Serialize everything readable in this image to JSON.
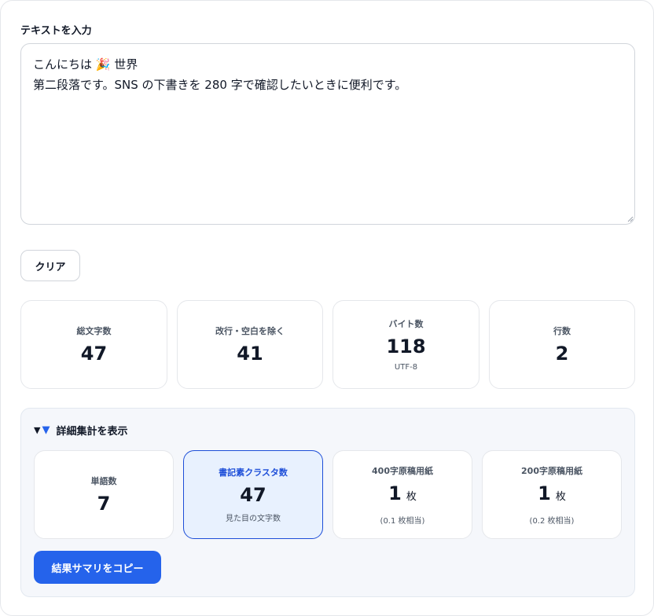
{
  "input": {
    "label": "テキストを入力",
    "text": "こんにちは 🎉 世界\n第二段落です。SNS の下書きを 280 字で確認したいときに便利です。"
  },
  "clear_label": "クリア",
  "stats": [
    {
      "label": "総文字数",
      "value": "47"
    },
    {
      "label": "改行・空白を除く",
      "value": "41"
    },
    {
      "label": "バイト数",
      "value": "118",
      "sub": "UTF-8"
    },
    {
      "label": "行数",
      "value": "2"
    }
  ],
  "details": {
    "summary_label": "詳細集計を表示",
    "items": [
      {
        "label": "単語数",
        "value": "7"
      },
      {
        "label": "書記素クラスタ数",
        "value": "47",
        "sub": "見た目の文字数"
      },
      {
        "label": "400字原稿用紙",
        "value": "1",
        "unit": "枚",
        "sub": "(0.1 枚相当)"
      },
      {
        "label": "200字原稿用紙",
        "value": "1",
        "unit": "枚",
        "sub": "(0.2 枚相当)"
      }
    ],
    "copy_label": "結果サマリをコピー"
  },
  "colors": {
    "accent": "#2563eb",
    "active_bg": "#e8f1fe"
  }
}
